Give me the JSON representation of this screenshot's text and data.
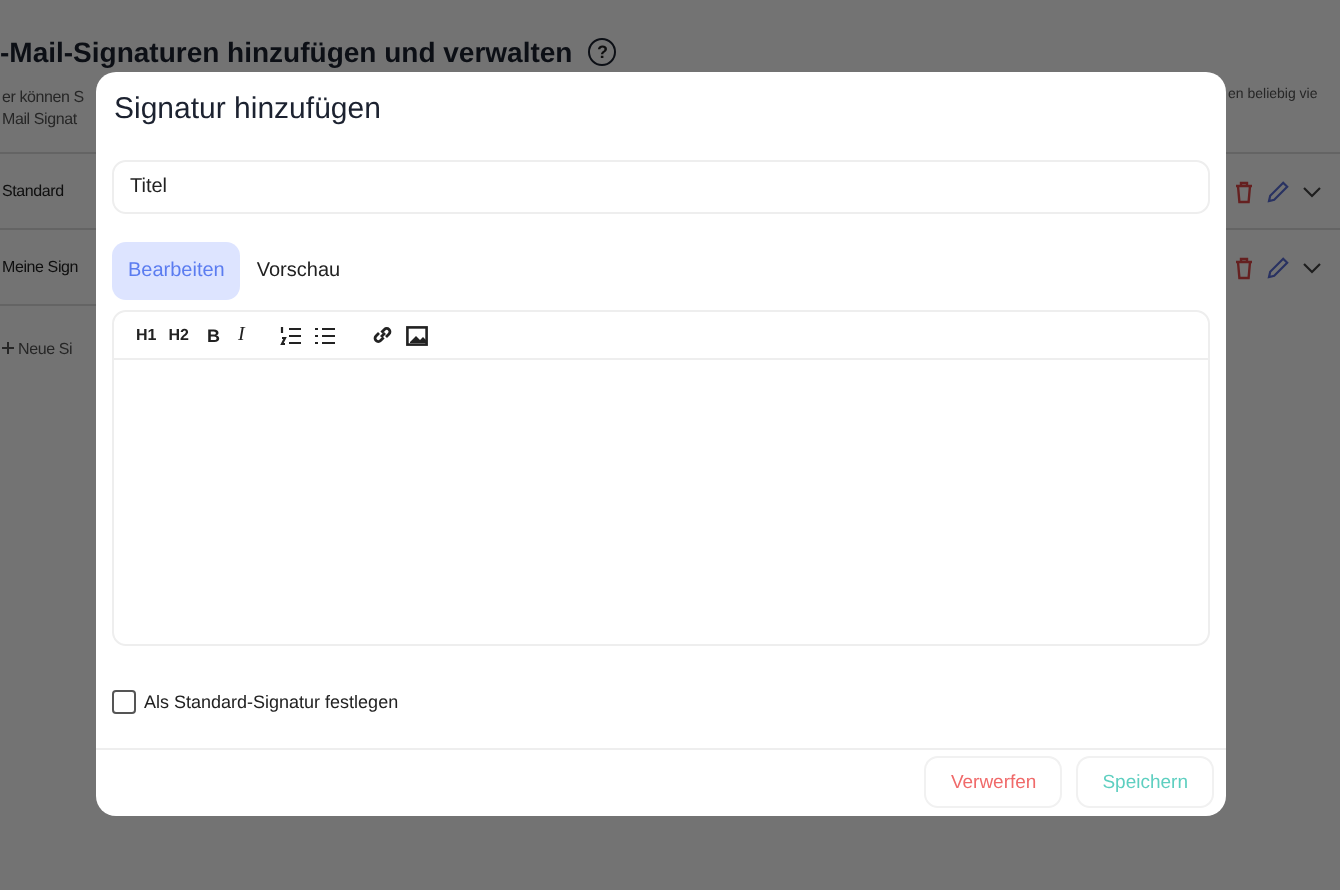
{
  "background": {
    "title": "-Mail-Signaturen hinzufügen und verwalten",
    "help_icon": "?",
    "left_texts": [
      "er können S",
      "Mail Signat"
    ],
    "right_text": "en beliebig vie",
    "signatures": [
      {
        "name": "Standard"
      },
      {
        "name": "Meine Sign"
      }
    ],
    "new_button": "Neue Si"
  },
  "dialog": {
    "title": "Signatur hinzufügen",
    "title_field": {
      "placeholder": "Titel"
    },
    "tabs": [
      {
        "label": "Bearbeiten",
        "selected": true
      },
      {
        "label": "Vorschau",
        "selected": false
      }
    ],
    "toolbar": [
      {
        "kind": "text",
        "label": "H1"
      },
      {
        "kind": "text",
        "label": "H2"
      },
      {
        "kind": "bold",
        "label": "B"
      },
      {
        "kind": "italic",
        "label": "I"
      },
      {
        "kind": "ordered-list"
      },
      {
        "kind": "bullet-list"
      },
      {
        "kind": "link"
      },
      {
        "kind": "image"
      }
    ],
    "default_checkbox": {
      "label": "Als Standard-Signatur festlegen",
      "checked": false
    },
    "buttons": [
      {
        "kind": "discard",
        "label": "Verwerfen"
      },
      {
        "kind": "save",
        "label": "Speichern"
      }
    ]
  }
}
